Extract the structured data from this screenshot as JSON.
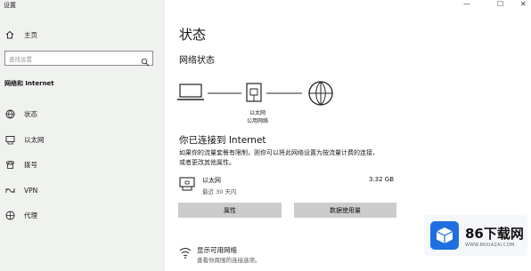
{
  "window": {
    "title": "设置",
    "controls": [
      "—",
      "☐",
      "✕"
    ]
  },
  "sidebar": {
    "home_label": "主页",
    "search_placeholder": "查找设置",
    "section_label": "网络和 Internet",
    "items": [
      {
        "label": "状态",
        "icon": "globe-status-icon"
      },
      {
        "label": "以太网",
        "icon": "ethernet-icon"
      },
      {
        "label": "拨号",
        "icon": "dialup-icon"
      },
      {
        "label": "VPN",
        "icon": "vpn-icon"
      },
      {
        "label": "代理",
        "icon": "proxy-globe-icon"
      }
    ]
  },
  "main": {
    "title": "状态",
    "network_status_heading": "网络状态",
    "diagram": {
      "middle_label_1": "以太网",
      "middle_label_2": "公用网络"
    },
    "connected_heading": "你已连接到 Internet",
    "connected_desc": "如果你的流量套餐有限制，则你可以将此网络设置为按流量计费的连接，或者更改其他属性。",
    "adapter": {
      "name": "以太网",
      "sub": "最近 30 天内",
      "usage": "3.32 GB"
    },
    "buttons": {
      "properties": "属性",
      "data_usage": "数据使用量"
    },
    "show_networks": {
      "title": "显示可用网络",
      "sub": "查看你周围的连接选项。"
    }
  },
  "watermark": {
    "brand": "86下载网",
    "url": "WWW.86XIAZAI.COM",
    "color": "#1f6fe0"
  }
}
